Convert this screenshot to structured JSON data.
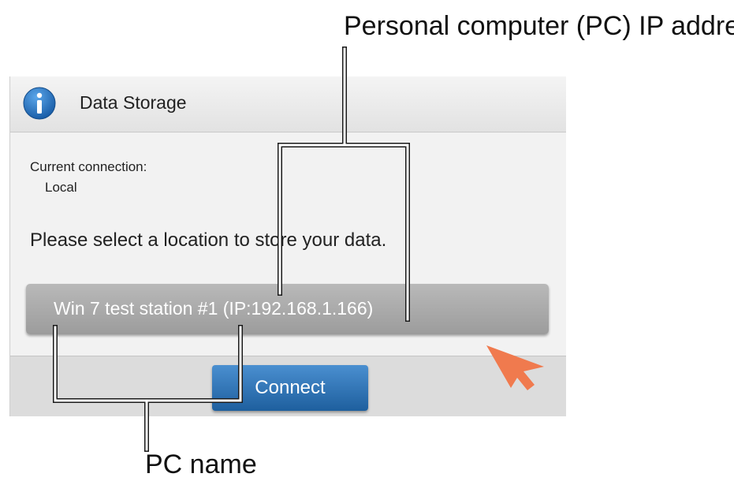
{
  "dialog": {
    "title": "Data Storage",
    "icon": "info-icon",
    "current_connection_label": "Current connection:",
    "current_connection_value": "Local",
    "prompt": "Please select a location to store your data.",
    "station_option": "Win 7 test station #1 (IP:192.168.1.166)",
    "connect_label": "Connect"
  },
  "annotations": {
    "ip_callout": "Personal computer (PC) IP address",
    "name_callout": "PC name",
    "pointer_icon": "arrow-pointer-icon"
  },
  "colors": {
    "accent_blue": "#2a6db2",
    "pointer_orange": "#f07a4e",
    "callout_line": "#ffffff"
  }
}
